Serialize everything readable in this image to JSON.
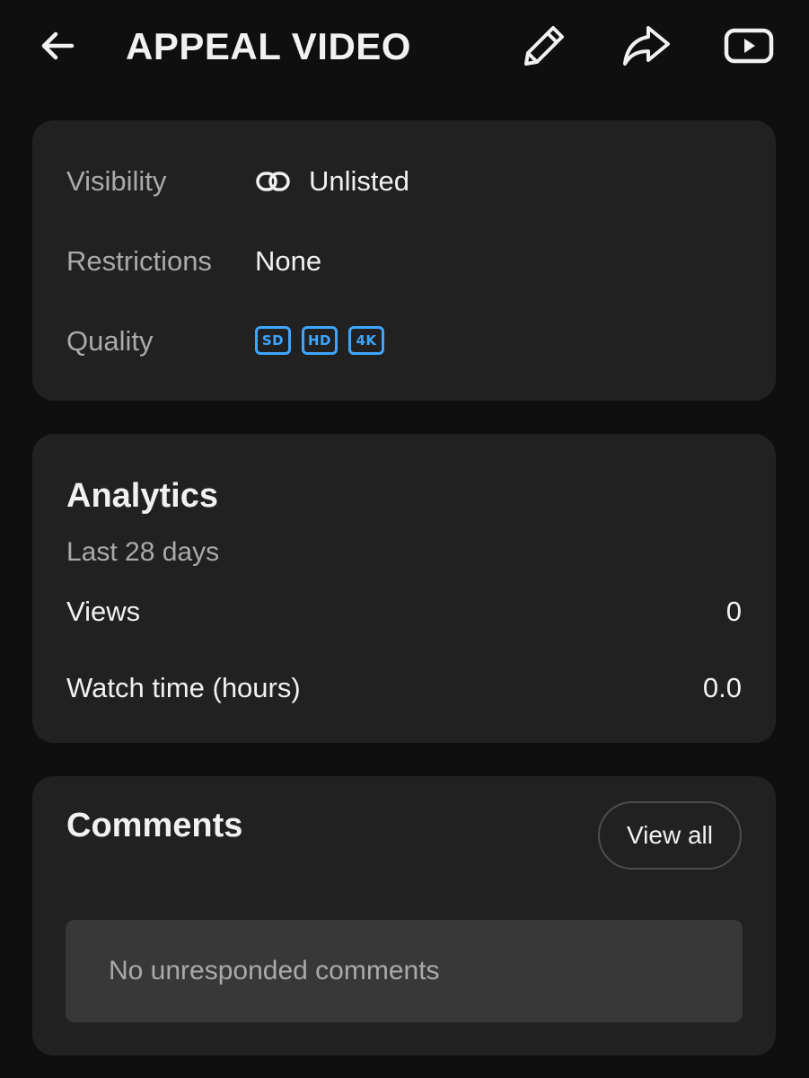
{
  "header": {
    "title": "APPEAL VIDEO",
    "back_icon": "arrow-left-icon",
    "edit_icon": "pencil-icon",
    "share_icon": "share-arrow-icon",
    "youtube_icon": "youtube-play-icon"
  },
  "details": {
    "visibility_label": "Visibility",
    "visibility_value": "Unlisted",
    "visibility_icon": "link-icon",
    "restrictions_label": "Restrictions",
    "restrictions_value": "None",
    "quality_label": "Quality",
    "quality_badges": [
      "SD",
      "HD",
      "4K"
    ]
  },
  "analytics": {
    "title": "Analytics",
    "period": "Last 28 days",
    "views_label": "Views",
    "views_value": "0",
    "watch_label": "Watch time (hours)",
    "watch_value": "0.0"
  },
  "comments": {
    "title": "Comments",
    "view_all_label": "View all",
    "empty_message": "No unresponded comments"
  },
  "colors": {
    "background": "#0f0f0f",
    "card": "#212121",
    "empty_box": "#383838",
    "text_primary": "#f1f1f1",
    "text_secondary": "#aaaaaa",
    "accent_blue": "#3ea6ff"
  }
}
